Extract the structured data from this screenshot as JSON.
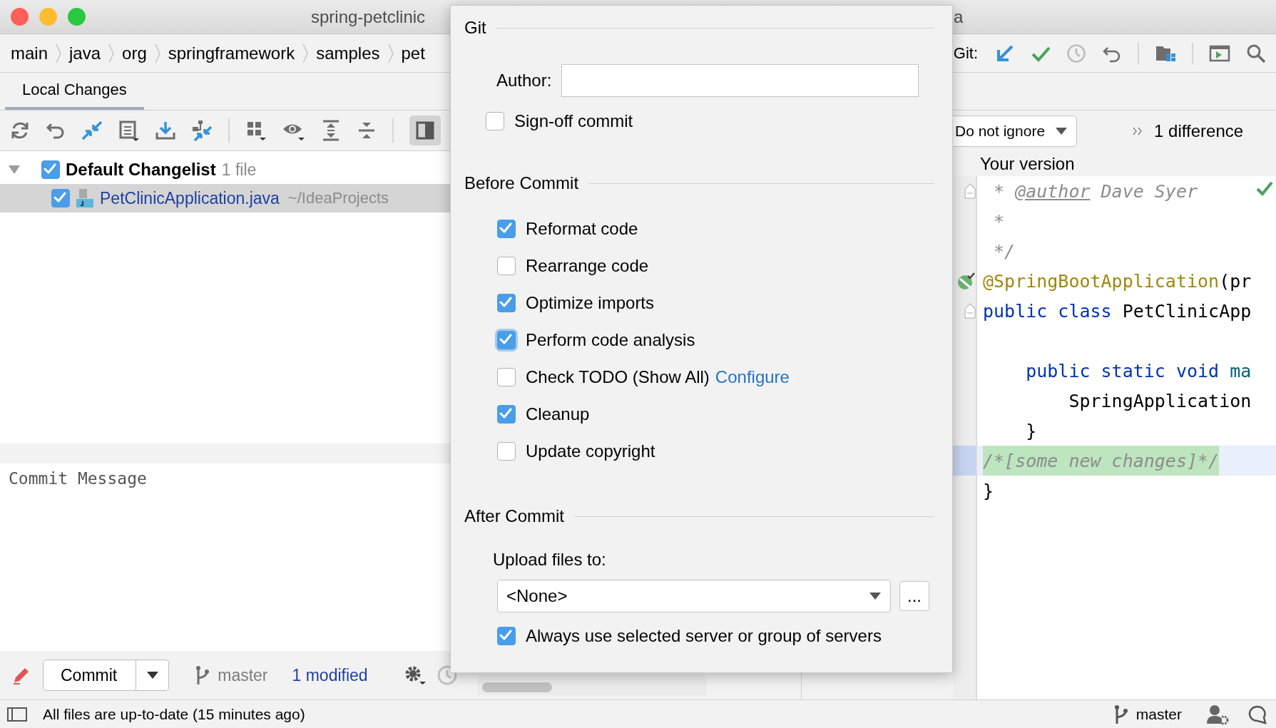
{
  "window": {
    "title": "spring-petclinic",
    "title_tail": "a"
  },
  "breadcrumbs": [
    "main",
    "java",
    "org",
    "springframework",
    "samples",
    "pet"
  ],
  "git_toolbar": {
    "label": "Git:"
  },
  "tabs": [
    {
      "label": "Local Changes",
      "selected": true
    }
  ],
  "toolbar": {
    "preview_selected": true
  },
  "changes": [
    {
      "name": "Default Changelist",
      "count": "1 file",
      "checked": true,
      "expanded": true,
      "children": [
        {
          "name": "PetClinicApplication.java",
          "path": "~/IdeaProjects",
          "checked": true,
          "selected": true
        }
      ]
    }
  ],
  "commit_message": {
    "placeholder": "Commit Message"
  },
  "commit_bar": {
    "button": "Commit",
    "branch": "master",
    "modified": "1 modified"
  },
  "diff": {
    "ignore": "Do not ignore",
    "differences": "1 difference",
    "side": "Your version",
    "lines": [
      {
        "kind": "fold",
        "changed": false,
        "tokens": [
          {
            "text": " * ",
            "kind": "comment"
          },
          {
            "text": "@author",
            "kind": "doctag"
          },
          {
            "text": " Dave Syer",
            "kind": "comment"
          }
        ]
      },
      {
        "kind": "plain",
        "changed": false,
        "tokens": [
          {
            "text": " *",
            "kind": "comment"
          }
        ]
      },
      {
        "kind": "plain",
        "changed": false,
        "tokens": [
          {
            "text": " */",
            "kind": "comment"
          }
        ]
      },
      {
        "kind": "bean",
        "changed": false,
        "tokens": [
          {
            "text": "@SpringBootApplication",
            "kind": "annotation"
          },
          {
            "text": "(pr",
            "kind": "plain"
          }
        ]
      },
      {
        "kind": "fold",
        "changed": false,
        "tokens": [
          {
            "text": "public class",
            "kind": "keyword"
          },
          {
            "text": " PetClinicApp",
            "kind": "plain"
          }
        ]
      },
      {
        "kind": "plain",
        "changed": false
      },
      {
        "kind": "plain",
        "changed": false,
        "tokens": [
          {
            "text": "    public static void",
            "kind": "keyword"
          },
          {
            "text": " ma",
            "kind": "method"
          }
        ]
      },
      {
        "kind": "plain",
        "changed": false,
        "tokens": [
          {
            "text": "        SpringApplication",
            "kind": "plain"
          }
        ]
      },
      {
        "kind": "plain",
        "changed": false,
        "tokens": [
          {
            "text": "    }",
            "kind": "plain"
          }
        ]
      },
      {
        "kind": "plain",
        "changed": true,
        "tokens": [
          {
            "text": "/*[some new changes]*/",
            "kind": "comment"
          }
        ]
      },
      {
        "kind": "plain",
        "changed": false,
        "tokens": [
          {
            "text": "}",
            "kind": "plain"
          }
        ]
      }
    ]
  },
  "dialog": {
    "git_title": "Git",
    "author": {
      "label": "Author:"
    },
    "signoff": {
      "label": "Sign-off commit",
      "checked": false
    },
    "before_title": "Before Commit",
    "before": [
      {
        "label": "Reformat code",
        "checked": true,
        "focused": false
      },
      {
        "label": "Rearrange code",
        "checked": false,
        "focused": false
      },
      {
        "label": "Optimize imports",
        "checked": true,
        "focused": false
      },
      {
        "label": "Perform code analysis",
        "checked": true,
        "focused": true
      },
      {
        "label": "Check TODO (Show All)",
        "checked": false,
        "focused": false,
        "link": "Configure"
      },
      {
        "label": "Cleanup",
        "checked": true,
        "focused": false
      },
      {
        "label": "Update copyright",
        "checked": false,
        "focused": false
      }
    ],
    "after_title": "After Commit",
    "upload_label": "Upload files to:",
    "upload_value": "<None>",
    "browse": "...",
    "always": {
      "label": "Always use selected server or group of servers",
      "checked": true
    }
  },
  "status_bar": {
    "message": "All files are up-to-date (15 minutes ago)",
    "branch": "master"
  }
}
